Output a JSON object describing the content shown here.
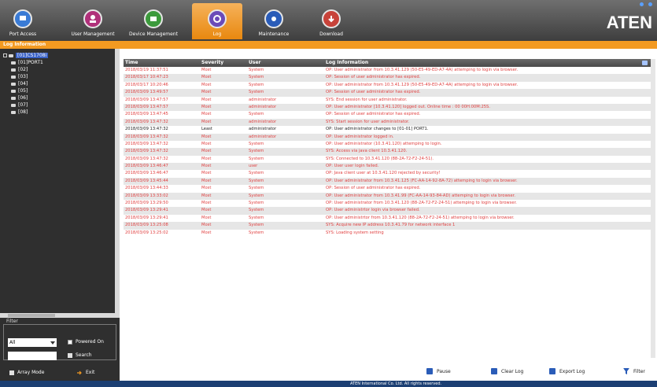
{
  "nav": {
    "items": [
      {
        "label": "Port Access",
        "icon": "port-access-icon"
      },
      {
        "label": "User Management",
        "icon": "user-management-icon"
      },
      {
        "label": "Device Management",
        "icon": "device-management-icon"
      },
      {
        "label": "Log",
        "icon": "log-icon",
        "active": true
      },
      {
        "label": "Maintenance",
        "icon": "maintenance-icon"
      },
      {
        "label": "Download",
        "icon": "download-icon"
      }
    ],
    "brand": "ATEN"
  },
  "subbar": {
    "title": "Log Information"
  },
  "tree": {
    "root": "[01]CS1708i",
    "items": [
      "[01]PORT1",
      "[02]",
      "[03]",
      "[04]",
      "[05]",
      "[06]",
      "[07]",
      "[08]"
    ]
  },
  "filter": {
    "legend": "Filter",
    "select_value": "All",
    "powered_on_label": "Powered On",
    "search_label": "Search"
  },
  "bottom_left": {
    "array_mode_label": "Array Mode",
    "exit_label": "Exit"
  },
  "table": {
    "headers": {
      "time": "Time",
      "severity": "Severity",
      "user": "User",
      "info": "Log Information"
    },
    "rows": [
      {
        "time": "2018/03/19 11:37:51",
        "severity": "Most",
        "user": "System",
        "info": "OP: User administrator from 10.3.41.129 (50-E5-49-ED-A7-4A) attemping to login via browser."
      },
      {
        "time": "2018/03/17 10:47:23",
        "severity": "Most",
        "user": "System",
        "info": "OP: Session of user administrator has expired."
      },
      {
        "time": "2018/03/17 10:20:46",
        "severity": "Most",
        "user": "System",
        "info": "OP: User administrator from 10.3.41.129 (50-E5-49-ED-A7-4A) attemping to login via browser."
      },
      {
        "time": "2018/03/09 13:49:57",
        "severity": "Most",
        "user": "System",
        "info": "OP: Session of user administrator has expired."
      },
      {
        "time": "2018/03/09 13:47:57",
        "severity": "Most",
        "user": "administrator",
        "info": "SYS: End session for user administrator."
      },
      {
        "time": "2018/03/09 13:47:57",
        "severity": "Most",
        "user": "administrator",
        "info": "OP: User administrator [10.3.41.120] logged out. Online time : 00 00H:00M:25S."
      },
      {
        "time": "2018/03/09 13:47:45",
        "severity": "Most",
        "user": "System",
        "info": "OP: Session of user administrator has expired."
      },
      {
        "time": "2018/03/09 13:47:32",
        "severity": "Most",
        "user": "administrator",
        "info": "SYS: Start session for user administrator."
      },
      {
        "time": "2018/03/09 13:47:32",
        "severity": "Least",
        "user": "administrator",
        "info": "OP: User administrator changes to [01-01] PORT1.",
        "normal": true
      },
      {
        "time": "2018/03/09 13:47:32",
        "severity": "Most",
        "user": "administrator",
        "info": "OP: User administrator logged in."
      },
      {
        "time": "2018/03/09 13:47:32",
        "severity": "Most",
        "user": "System",
        "info": "OP: User administrator (10.3.41.120) attemping to login."
      },
      {
        "time": "2018/03/09 13:47:32",
        "severity": "Most",
        "user": "System",
        "info": "SYS: Access via java client 10.3.41.120."
      },
      {
        "time": "2018/03/09 13:47:32",
        "severity": "Most",
        "user": "System",
        "info": "SYS: Connected to 10.3.41.120 (88-2A-72-F2-24-51)."
      },
      {
        "time": "2018/03/09 13:46:47",
        "severity": "Most",
        "user": "user",
        "info": "OP: User user login failed."
      },
      {
        "time": "2018/03/09 13:46:47",
        "severity": "Most",
        "user": "System",
        "info": "OP: Java client user at 10.3.41.120 rejected by security!"
      },
      {
        "time": "2018/03/09 13:45:44",
        "severity": "Most",
        "user": "System",
        "info": "OP: User administrator from 10.3.41.125 (FC-AA-14-92-8A-72) attemping to login via browser."
      },
      {
        "time": "2018/03/09 13:44:33",
        "severity": "Most",
        "user": "System",
        "info": "OP: Session of user administrator has expired."
      },
      {
        "time": "2018/03/09 13:33:02",
        "severity": "Most",
        "user": "System",
        "info": "OP: User administrator from 10.3.41.99 (FC-AA-14-93-84-AD) attemping to login via browser."
      },
      {
        "time": "2018/03/09 13:29:50",
        "severity": "Most",
        "user": "System",
        "info": "OP: User administrator from 10.3.41.120 (88-2A-72-F2-24-51) attemping to login via browser."
      },
      {
        "time": "2018/03/09 13:29:41",
        "severity": "Most",
        "user": "System",
        "info": "OP: User administrtor login via browser failed."
      },
      {
        "time": "2018/03/09 13:29:41",
        "severity": "Most",
        "user": "System",
        "info": "OP: User administrtor from 10.3.41.120 (88-2A-72-F2-24-51) attemping to login via browser."
      },
      {
        "time": "2018/03/09 13:25:08",
        "severity": "Most",
        "user": "System",
        "info": "SYS: Acquire new IP address 10.3.41.79 for network interface 1"
      },
      {
        "time": "2018/03/09 13:25:02",
        "severity": "Most",
        "user": "System",
        "info": "SYS: Loading system setting"
      }
    ]
  },
  "toolbar": {
    "pause_label": "Pause",
    "clear_log_label": "Clear Log",
    "export_log_label": "Export Log",
    "filter_label": "Filter"
  },
  "footer": {
    "text": "ATEN International Co. Ltd. All rights reserved."
  },
  "colors": {
    "accent": "#f39a21",
    "error_text": "#e04040",
    "footer": "#1c3f73"
  }
}
